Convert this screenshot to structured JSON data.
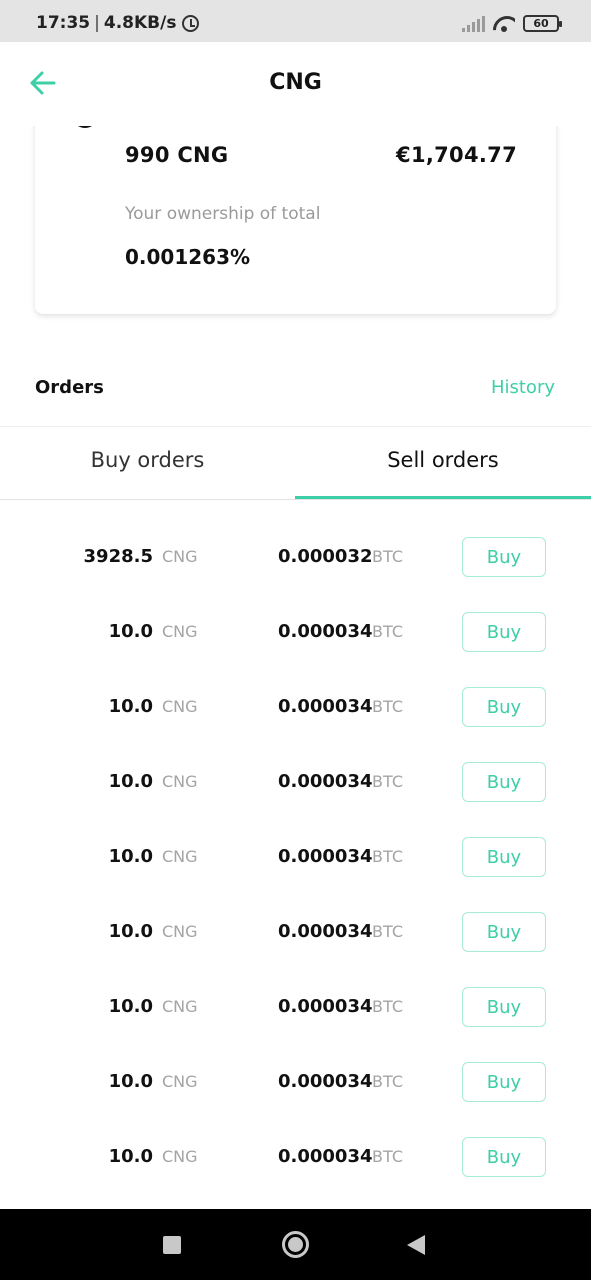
{
  "status_bar": {
    "time": "17:35",
    "speed": "4.8KB/s",
    "battery": "60",
    "icons": [
      "alarm-icon",
      "signal-icon",
      "wifi-icon",
      "battery-icon"
    ]
  },
  "header": {
    "title": "CNG",
    "back_icon": "arrow-left-icon"
  },
  "holding": {
    "amount": "990 CNG",
    "value": "€1,704.77",
    "ownership_label": "Your ownership of total",
    "ownership_value": "0.001263%"
  },
  "orders": {
    "title": "Orders",
    "history_label": "History",
    "tabs": [
      {
        "label": "Buy orders",
        "active": false
      },
      {
        "label": "Sell orders",
        "active": true
      }
    ],
    "rows": [
      {
        "qty": "3928.5",
        "qty_unit": "CNG",
        "price": "0.000032",
        "price_unit": "BTC",
        "action": "Buy"
      },
      {
        "qty": "10.0",
        "qty_unit": "CNG",
        "price": "0.000034",
        "price_unit": "BTC",
        "action": "Buy"
      },
      {
        "qty": "10.0",
        "qty_unit": "CNG",
        "price": "0.000034",
        "price_unit": "BTC",
        "action": "Buy"
      },
      {
        "qty": "10.0",
        "qty_unit": "CNG",
        "price": "0.000034",
        "price_unit": "BTC",
        "action": "Buy"
      },
      {
        "qty": "10.0",
        "qty_unit": "CNG",
        "price": "0.000034",
        "price_unit": "BTC",
        "action": "Buy"
      },
      {
        "qty": "10.0",
        "qty_unit": "CNG",
        "price": "0.000034",
        "price_unit": "BTC",
        "action": "Buy"
      },
      {
        "qty": "10.0",
        "qty_unit": "CNG",
        "price": "0.000034",
        "price_unit": "BTC",
        "action": "Buy"
      },
      {
        "qty": "10.0",
        "qty_unit": "CNG",
        "price": "0.000034",
        "price_unit": "BTC",
        "action": "Buy"
      },
      {
        "qty": "10.0",
        "qty_unit": "CNG",
        "price": "0.000034",
        "price_unit": "BTC",
        "action": "Buy"
      }
    ]
  },
  "nav_bar": {
    "icons": [
      "recents-square-icon",
      "home-circle-icon",
      "back-triangle-icon"
    ]
  },
  "colors": {
    "accent": "#3ecfa6",
    "muted_text": "#9a9a9a",
    "status_bar_bg": "#e4e4e4",
    "nav_bar_bg": "#000000"
  }
}
